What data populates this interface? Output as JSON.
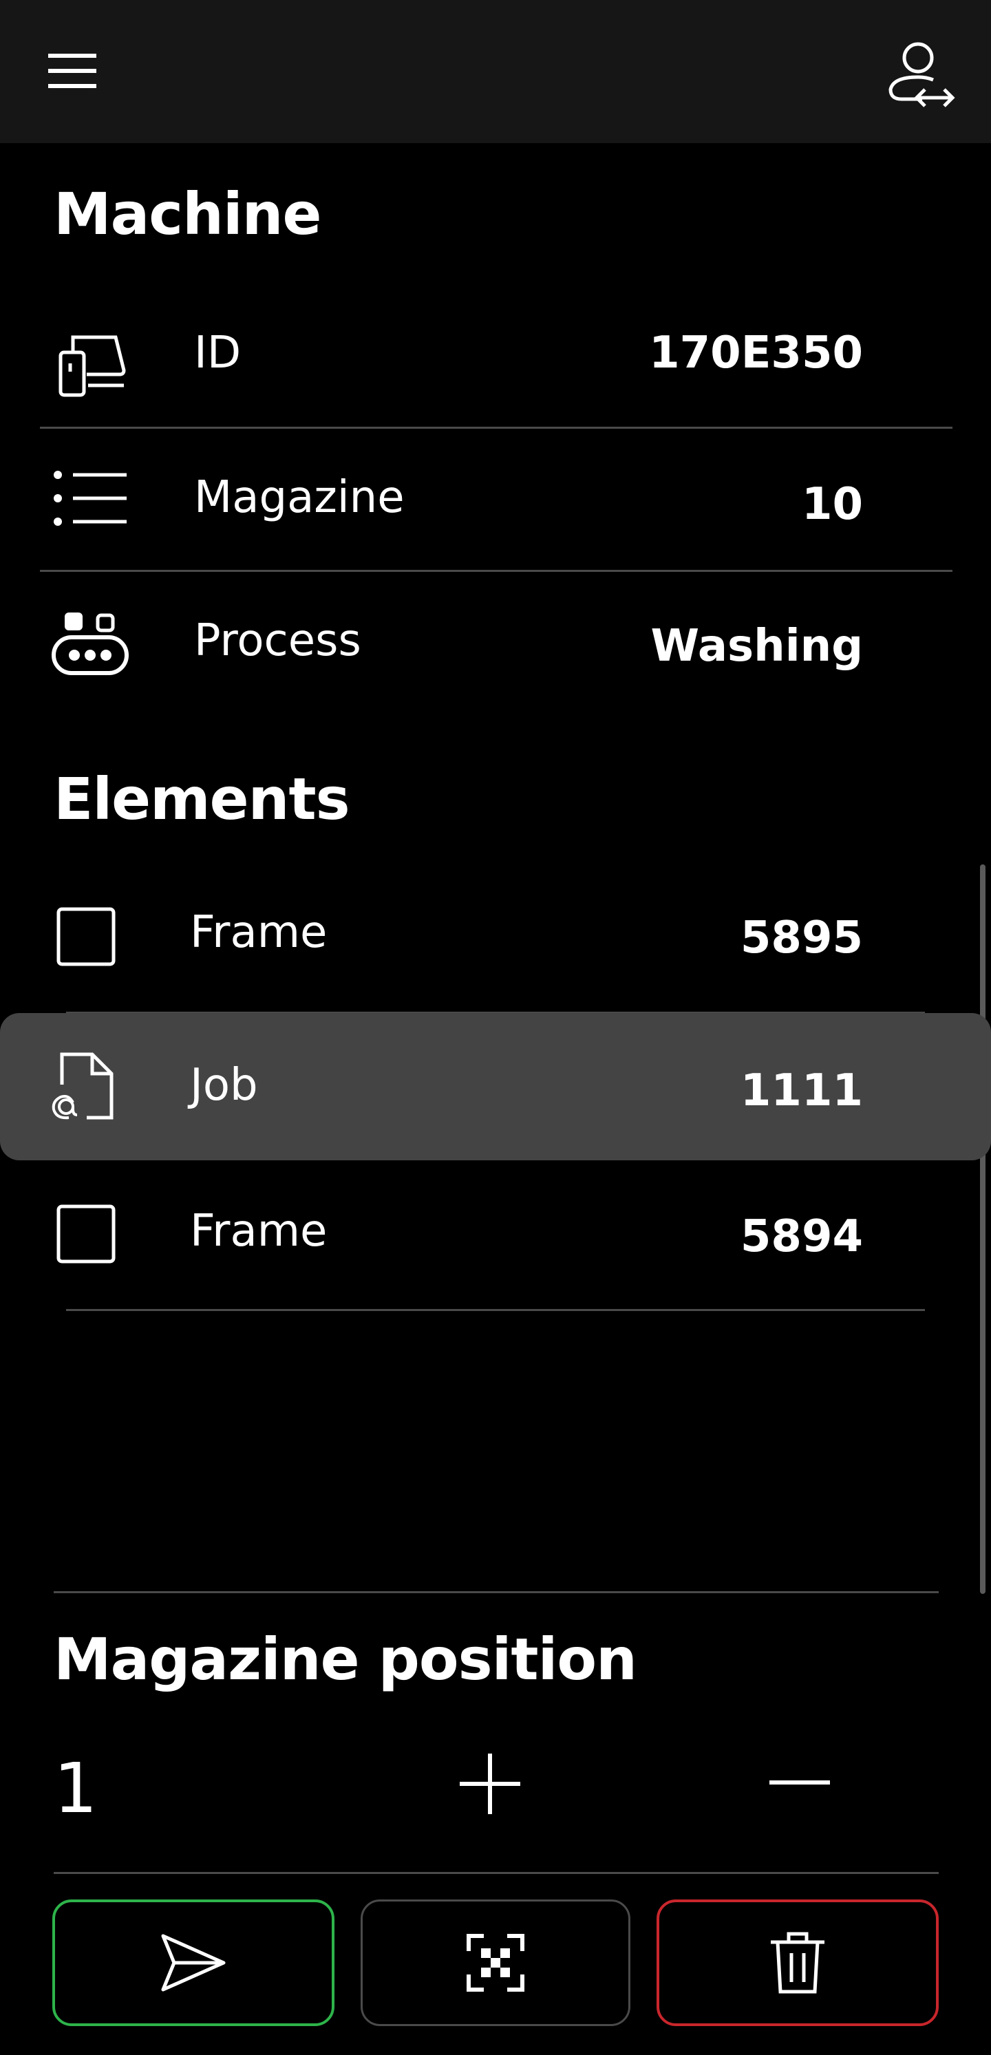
{
  "header": {
    "menu_icon": "hamburger-menu-icon",
    "user_icon": "user-switch-icon"
  },
  "machine": {
    "title": "Machine",
    "rows": [
      {
        "icon": "machine-device-icon",
        "label": "ID",
        "value": "170E350"
      },
      {
        "icon": "list-icon",
        "label": "Magazine",
        "value": "10"
      },
      {
        "icon": "conveyor-process-icon",
        "label": "Process",
        "value": "Washing"
      }
    ]
  },
  "elements": {
    "title": "Elements",
    "items": [
      {
        "icon": "frame-square-icon",
        "label": "Frame",
        "value": "5895",
        "selected": false
      },
      {
        "icon": "job-file-icon",
        "label": "Job",
        "value": "1111",
        "selected": true
      },
      {
        "icon": "frame-square-icon",
        "label": "Frame",
        "value": "5894",
        "selected": false
      }
    ]
  },
  "magazine_position": {
    "title": "Magazine position",
    "value": "1"
  },
  "actions": {
    "send_icon": "send-icon",
    "scan_icon": "scan-qr-icon",
    "delete_icon": "trash-icon",
    "colors": {
      "send": "#2eb34a",
      "scan": "#4a4a4a",
      "delete": "#c8262c"
    }
  }
}
